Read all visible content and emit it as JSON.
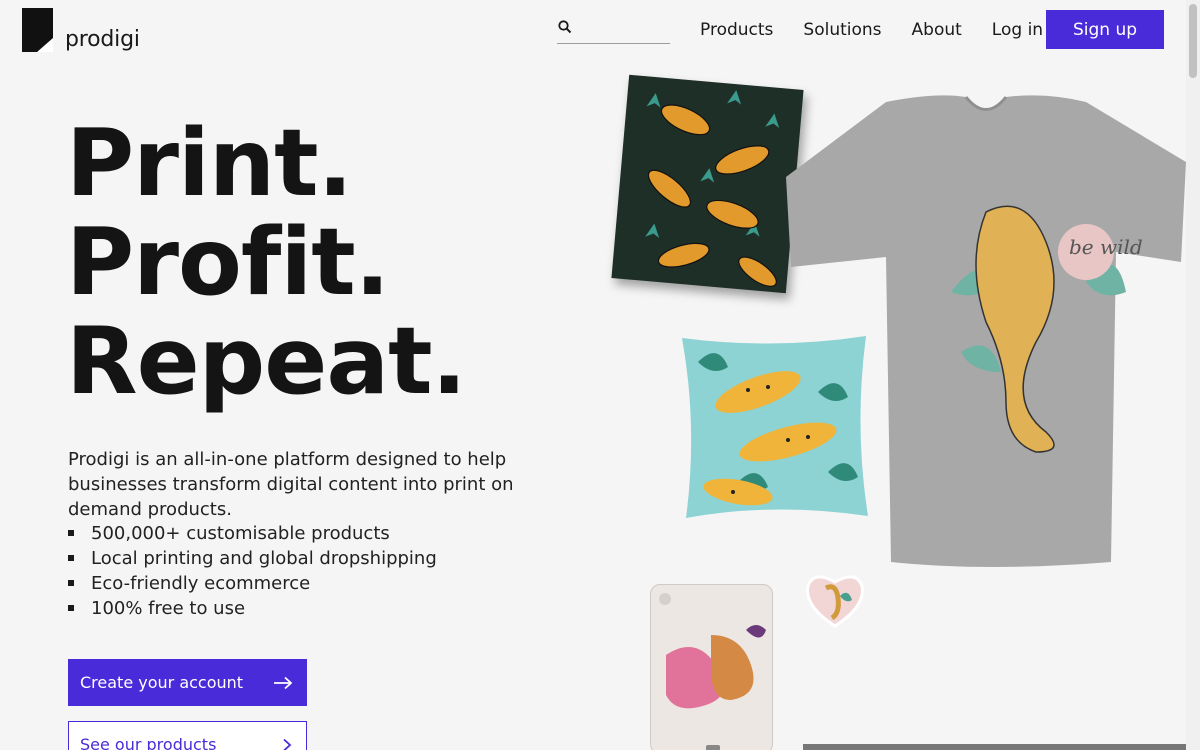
{
  "brand": {
    "name": "prodigi"
  },
  "search": {
    "placeholder": "",
    "value": ""
  },
  "nav": {
    "items": [
      "Products",
      "Solutions",
      "About",
      "Log in"
    ]
  },
  "signup_label": "Sign up",
  "hero": {
    "lines": [
      "Print.",
      "Profit.",
      "Repeat."
    ],
    "description": "Prodigi is an all-in-one platform designed to help businesses transform digital content into print on demand products.",
    "features": [
      "500,000+ customisable products",
      "Local printing and global dropshipping",
      "Eco-friendly ecommerce",
      "100% free to use"
    ],
    "cta_primary": "Create your account",
    "cta_secondary": "See our products"
  },
  "colors": {
    "accent": "#4a2bd9",
    "background": "#f5f5f5"
  },
  "icons": [
    "prodigi-logo-icon",
    "search-icon",
    "arrow-right-icon",
    "chevron-right-icon"
  ],
  "products": {
    "tshirt_print_text": "be wild"
  }
}
